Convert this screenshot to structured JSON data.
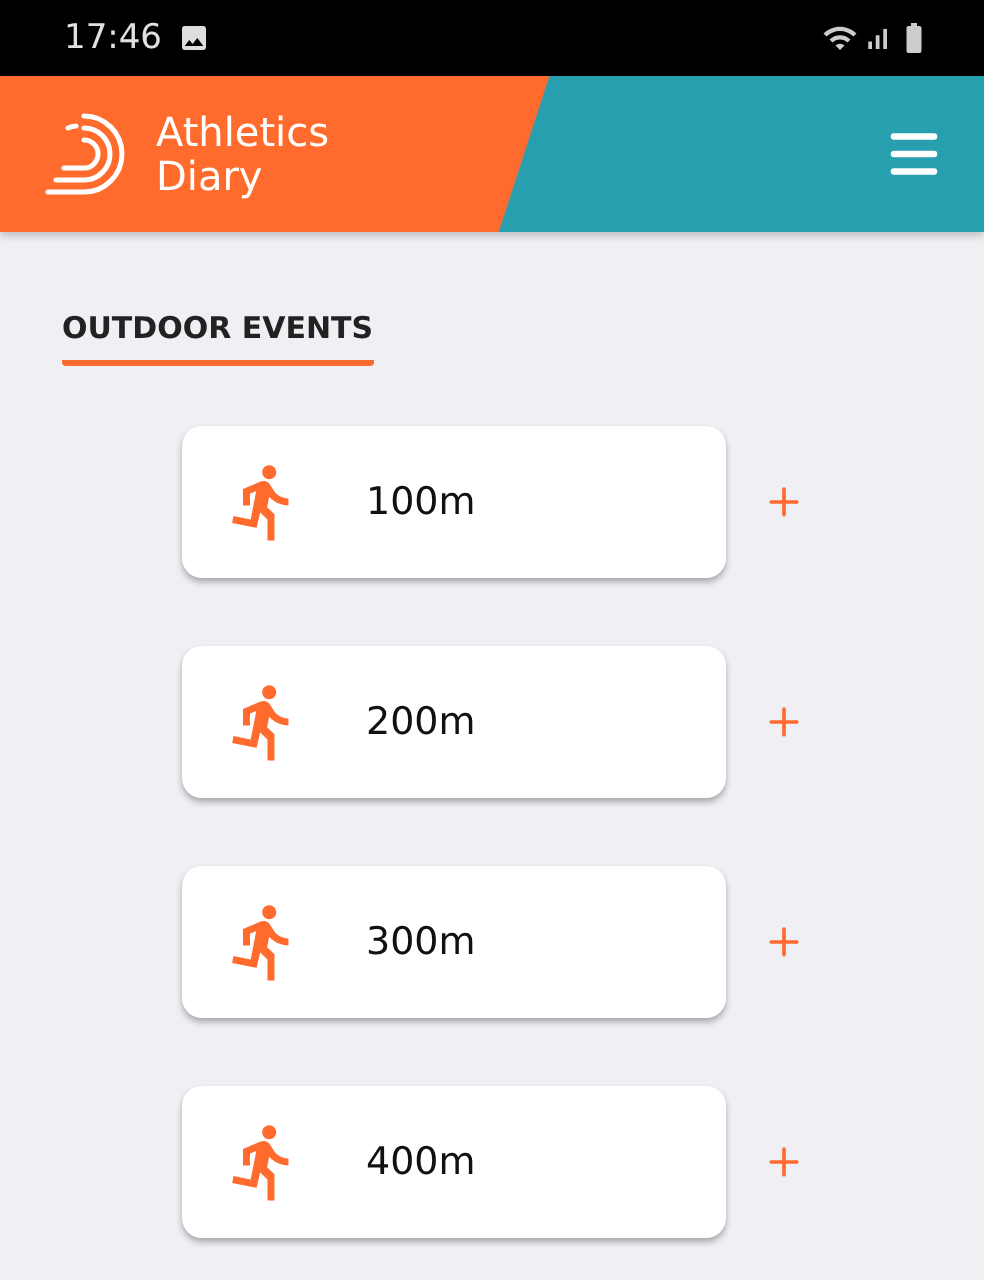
{
  "status_bar": {
    "time": "17:46"
  },
  "header": {
    "title_lines": [
      "Athletics",
      "Diary"
    ]
  },
  "section": {
    "title": "OUTDOOR EVENTS"
  },
  "events": [
    {
      "label": "100m"
    },
    {
      "label": "200m"
    },
    {
      "label": "300m"
    },
    {
      "label": "400m"
    }
  ]
}
